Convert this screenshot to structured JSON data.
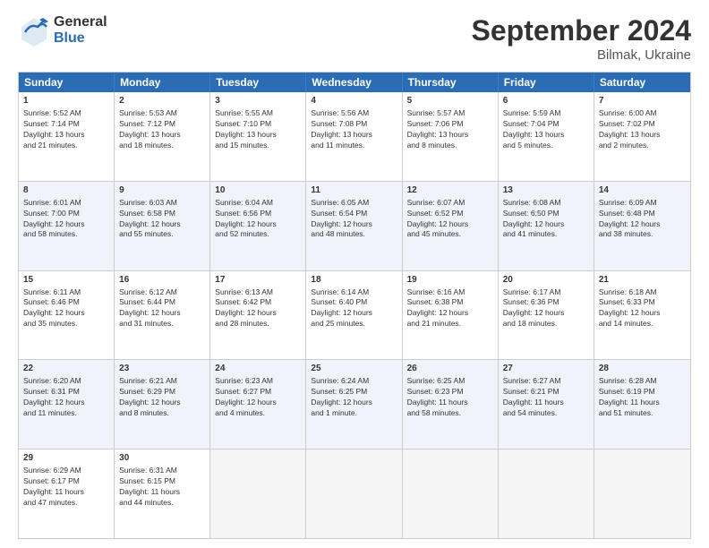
{
  "logo": {
    "general": "General",
    "blue": "Blue"
  },
  "title": {
    "month": "September 2024",
    "location": "Bilmak, Ukraine"
  },
  "headers": [
    "Sunday",
    "Monday",
    "Tuesday",
    "Wednesday",
    "Thursday",
    "Friday",
    "Saturday"
  ],
  "rows": [
    [
      {
        "day": "1",
        "lines": [
          "Sunrise: 5:52 AM",
          "Sunset: 7:14 PM",
          "Daylight: 13 hours",
          "and 21 minutes."
        ]
      },
      {
        "day": "2",
        "lines": [
          "Sunrise: 5:53 AM",
          "Sunset: 7:12 PM",
          "Daylight: 13 hours",
          "and 18 minutes."
        ]
      },
      {
        "day": "3",
        "lines": [
          "Sunrise: 5:55 AM",
          "Sunset: 7:10 PM",
          "Daylight: 13 hours",
          "and 15 minutes."
        ]
      },
      {
        "day": "4",
        "lines": [
          "Sunrise: 5:56 AM",
          "Sunset: 7:08 PM",
          "Daylight: 13 hours",
          "and 11 minutes."
        ]
      },
      {
        "day": "5",
        "lines": [
          "Sunrise: 5:57 AM",
          "Sunset: 7:06 PM",
          "Daylight: 13 hours",
          "and 8 minutes."
        ]
      },
      {
        "day": "6",
        "lines": [
          "Sunrise: 5:59 AM",
          "Sunset: 7:04 PM",
          "Daylight: 13 hours",
          "and 5 minutes."
        ]
      },
      {
        "day": "7",
        "lines": [
          "Sunrise: 6:00 AM",
          "Sunset: 7:02 PM",
          "Daylight: 13 hours",
          "and 2 minutes."
        ]
      }
    ],
    [
      {
        "day": "8",
        "lines": [
          "Sunrise: 6:01 AM",
          "Sunset: 7:00 PM",
          "Daylight: 12 hours",
          "and 58 minutes."
        ]
      },
      {
        "day": "9",
        "lines": [
          "Sunrise: 6:03 AM",
          "Sunset: 6:58 PM",
          "Daylight: 12 hours",
          "and 55 minutes."
        ]
      },
      {
        "day": "10",
        "lines": [
          "Sunrise: 6:04 AM",
          "Sunset: 6:56 PM",
          "Daylight: 12 hours",
          "and 52 minutes."
        ]
      },
      {
        "day": "11",
        "lines": [
          "Sunrise: 6:05 AM",
          "Sunset: 6:54 PM",
          "Daylight: 12 hours",
          "and 48 minutes."
        ]
      },
      {
        "day": "12",
        "lines": [
          "Sunrise: 6:07 AM",
          "Sunset: 6:52 PM",
          "Daylight: 12 hours",
          "and 45 minutes."
        ]
      },
      {
        "day": "13",
        "lines": [
          "Sunrise: 6:08 AM",
          "Sunset: 6:50 PM",
          "Daylight: 12 hours",
          "and 41 minutes."
        ]
      },
      {
        "day": "14",
        "lines": [
          "Sunrise: 6:09 AM",
          "Sunset: 6:48 PM",
          "Daylight: 12 hours",
          "and 38 minutes."
        ]
      }
    ],
    [
      {
        "day": "15",
        "lines": [
          "Sunrise: 6:11 AM",
          "Sunset: 6:46 PM",
          "Daylight: 12 hours",
          "and 35 minutes."
        ]
      },
      {
        "day": "16",
        "lines": [
          "Sunrise: 6:12 AM",
          "Sunset: 6:44 PM",
          "Daylight: 12 hours",
          "and 31 minutes."
        ]
      },
      {
        "day": "17",
        "lines": [
          "Sunrise: 6:13 AM",
          "Sunset: 6:42 PM",
          "Daylight: 12 hours",
          "and 28 minutes."
        ]
      },
      {
        "day": "18",
        "lines": [
          "Sunrise: 6:14 AM",
          "Sunset: 6:40 PM",
          "Daylight: 12 hours",
          "and 25 minutes."
        ]
      },
      {
        "day": "19",
        "lines": [
          "Sunrise: 6:16 AM",
          "Sunset: 6:38 PM",
          "Daylight: 12 hours",
          "and 21 minutes."
        ]
      },
      {
        "day": "20",
        "lines": [
          "Sunrise: 6:17 AM",
          "Sunset: 6:36 PM",
          "Daylight: 12 hours",
          "and 18 minutes."
        ]
      },
      {
        "day": "21",
        "lines": [
          "Sunrise: 6:18 AM",
          "Sunset: 6:33 PM",
          "Daylight: 12 hours",
          "and 14 minutes."
        ]
      }
    ],
    [
      {
        "day": "22",
        "lines": [
          "Sunrise: 6:20 AM",
          "Sunset: 6:31 PM",
          "Daylight: 12 hours",
          "and 11 minutes."
        ]
      },
      {
        "day": "23",
        "lines": [
          "Sunrise: 6:21 AM",
          "Sunset: 6:29 PM",
          "Daylight: 12 hours",
          "and 8 minutes."
        ]
      },
      {
        "day": "24",
        "lines": [
          "Sunrise: 6:23 AM",
          "Sunset: 6:27 PM",
          "Daylight: 12 hours",
          "and 4 minutes."
        ]
      },
      {
        "day": "25",
        "lines": [
          "Sunrise: 6:24 AM",
          "Sunset: 6:25 PM",
          "Daylight: 12 hours",
          "and 1 minute."
        ]
      },
      {
        "day": "26",
        "lines": [
          "Sunrise: 6:25 AM",
          "Sunset: 6:23 PM",
          "Daylight: 11 hours",
          "and 58 minutes."
        ]
      },
      {
        "day": "27",
        "lines": [
          "Sunrise: 6:27 AM",
          "Sunset: 6:21 PM",
          "Daylight: 11 hours",
          "and 54 minutes."
        ]
      },
      {
        "day": "28",
        "lines": [
          "Sunrise: 6:28 AM",
          "Sunset: 6:19 PM",
          "Daylight: 11 hours",
          "and 51 minutes."
        ]
      }
    ],
    [
      {
        "day": "29",
        "lines": [
          "Sunrise: 6:29 AM",
          "Sunset: 6:17 PM",
          "Daylight: 11 hours",
          "and 47 minutes."
        ]
      },
      {
        "day": "30",
        "lines": [
          "Sunrise: 6:31 AM",
          "Sunset: 6:15 PM",
          "Daylight: 11 hours",
          "and 44 minutes."
        ]
      },
      {
        "day": "",
        "lines": []
      },
      {
        "day": "",
        "lines": []
      },
      {
        "day": "",
        "lines": []
      },
      {
        "day": "",
        "lines": []
      },
      {
        "day": "",
        "lines": []
      }
    ]
  ]
}
